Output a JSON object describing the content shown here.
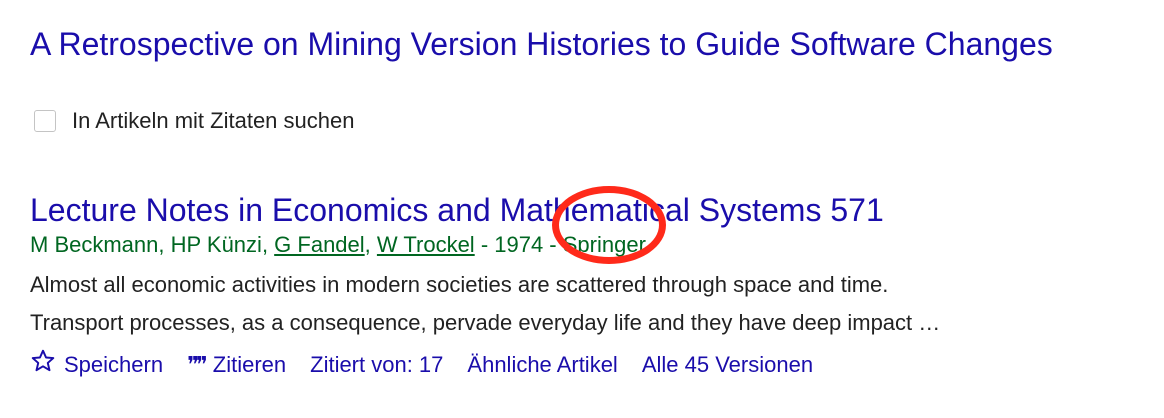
{
  "top_result": {
    "title": "A Retrospective on Mining Version Histories to Guide Software Changes",
    "cite_search_label": "In Artikeln mit Zitaten suchen"
  },
  "result": {
    "title": "Lecture Notes in Economics and Mathematical Systems 571",
    "authors": {
      "plain_1": "M Beckmann",
      "sep_1": ", ",
      "plain_2": "HP Künzi",
      "sep_2": ", ",
      "link_1": "G Fandel",
      "sep_3": ", ",
      "link_2": "W Trockel",
      "year_segment": " - 1974 - ",
      "publisher": "Springer"
    },
    "snippet_line_1": "Almost all economic activities in modern societies are scattered through space and time.",
    "snippet_line_2": "Transport processes, as a consequence, pervade everyday life and they have deep impact …",
    "actions": {
      "save": "Speichern",
      "cite": "Zitieren",
      "cited_by": "Zitiert von: 17",
      "related": "Ähnliche Artikel",
      "versions": "Alle 45 Versionen"
    }
  },
  "colors": {
    "link_blue": "#1a0dab",
    "meta_green": "#006621",
    "highlight_red": "#ff2a1a"
  },
  "icons": {
    "save": "star-outline-icon",
    "cite": "quote-icon"
  }
}
